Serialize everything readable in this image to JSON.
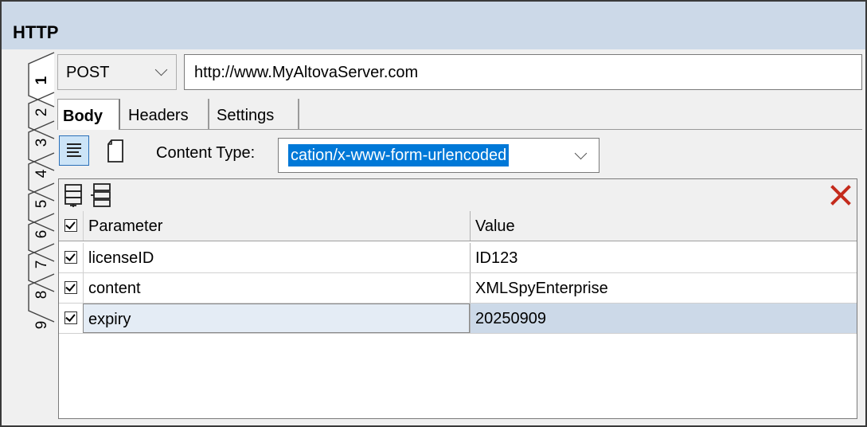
{
  "window": {
    "title": "HTTP"
  },
  "side_tabs": [
    "1",
    "2",
    "3",
    "4",
    "5",
    "6",
    "7",
    "8",
    "9"
  ],
  "request": {
    "method": "POST",
    "url": "http://www.MyAltovaServer.com"
  },
  "tabs": [
    {
      "label": "Body",
      "active": true
    },
    {
      "label": "Headers",
      "active": false
    },
    {
      "label": "Settings",
      "active": false
    }
  ],
  "content_type": {
    "label": "Content Type:",
    "value": "cation/x-www-form-urlencoded"
  },
  "grid": {
    "columns": [
      "Parameter",
      "Value"
    ],
    "rows": [
      {
        "checked": true,
        "parameter": "licenseID",
        "value": "ID123"
      },
      {
        "checked": true,
        "parameter": "content",
        "value": "XMLSpyEnterprise"
      },
      {
        "checked": true,
        "parameter": "expiry",
        "value": "20250909",
        "selected": true
      }
    ]
  },
  "colors": {
    "titlebar": "#ccd9e8",
    "selection": "#0078d7",
    "delete": "#c42b1c"
  }
}
